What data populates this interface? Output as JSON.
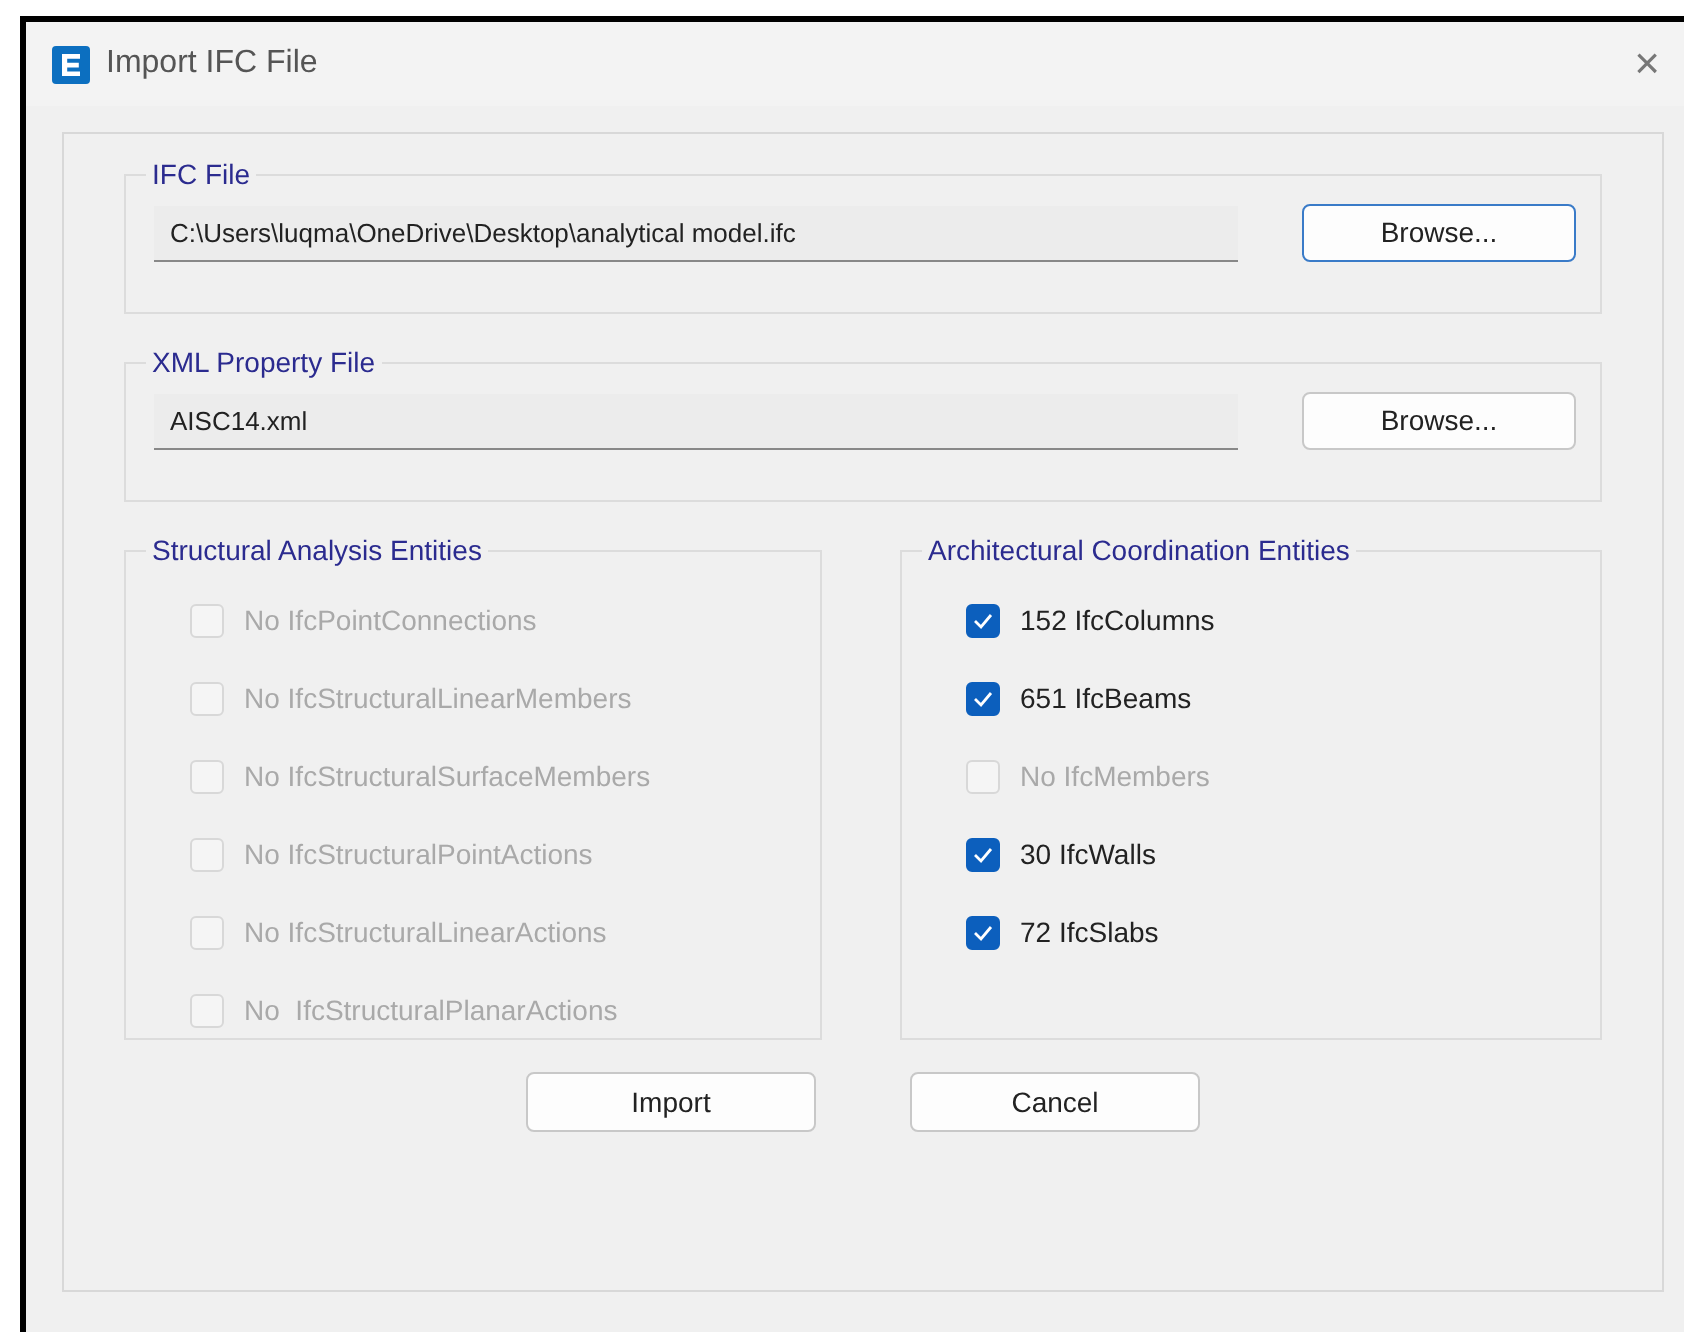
{
  "window": {
    "title": "Import IFC File",
    "close": "×"
  },
  "ifc_file": {
    "legend": "IFC File",
    "value": "C:\\Users\\luqma\\OneDrive\\Desktop\\analytical model.ifc",
    "button": "Browse...",
    "button_focused": true
  },
  "xml_file": {
    "legend": "XML Property File",
    "value": "AISC14.xml",
    "button": "Browse...",
    "button_focused": false
  },
  "structural": {
    "legend": "Structural Analysis Entities",
    "items": [
      {
        "label": "No IfcPointConnections",
        "checked": false,
        "disabled": true
      },
      {
        "label": "No IfcStructuralLinearMembers",
        "checked": false,
        "disabled": true
      },
      {
        "label": "No IfcStructuralSurfaceMembers",
        "checked": false,
        "disabled": true
      },
      {
        "label": "No IfcStructuralPointActions",
        "checked": false,
        "disabled": true
      },
      {
        "label": "No IfcStructuralLinearActions",
        "checked": false,
        "disabled": true
      },
      {
        "label": "No  IfcStructuralPlanarActions",
        "checked": false,
        "disabled": true
      }
    ]
  },
  "architectural": {
    "legend": "Architectural Coordination Entities",
    "items": [
      {
        "label": "152 IfcColumns",
        "checked": true,
        "disabled": false
      },
      {
        "label": "651 IfcBeams",
        "checked": true,
        "disabled": false
      },
      {
        "label": "No IfcMembers",
        "checked": false,
        "disabled": true
      },
      {
        "label": "30 IfcWalls",
        "checked": true,
        "disabled": false
      },
      {
        "label": "72 IfcSlabs",
        "checked": true,
        "disabled": false
      }
    ]
  },
  "buttons": [
    "Import",
    "Cancel"
  ]
}
